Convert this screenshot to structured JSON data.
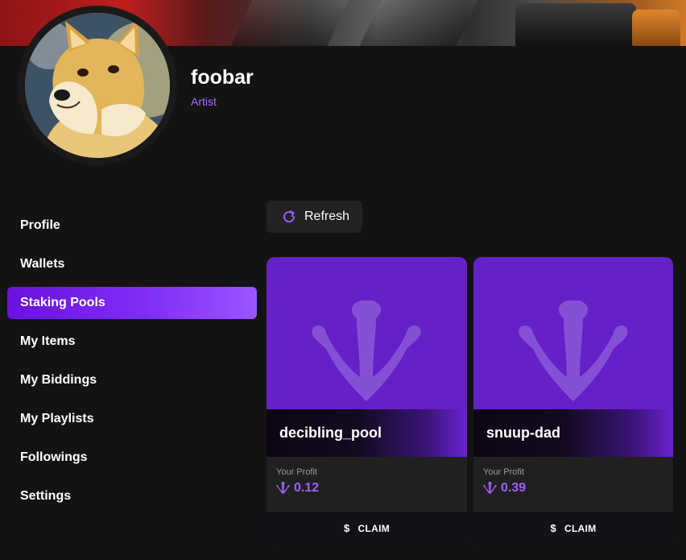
{
  "profile": {
    "username": "foobar",
    "role": "Artist"
  },
  "sidebar": {
    "items": [
      {
        "label": "Profile",
        "active": false
      },
      {
        "label": "Wallets",
        "active": false
      },
      {
        "label": "Staking Pools",
        "active": true
      },
      {
        "label": "My Items",
        "active": false
      },
      {
        "label": "My Biddings",
        "active": false
      },
      {
        "label": "My Playlists",
        "active": false
      },
      {
        "label": "Followings",
        "active": false
      },
      {
        "label": "Settings",
        "active": false
      }
    ]
  },
  "toolbar": {
    "refresh_label": "Refresh",
    "refresh_icon": "refresh-icon"
  },
  "pools": [
    {
      "name": "decibling_pool",
      "profit_label": "Your Profit",
      "profit_value": "0.12",
      "claim_label": "CLAIM",
      "claim_icon": "$"
    },
    {
      "name": "snuup-dad",
      "profit_label": "Your Profit",
      "profit_value": "0.39",
      "claim_label": "CLAIM",
      "claim_icon": "$"
    }
  ],
  "colors": {
    "accent": "#7f2df5",
    "card_image": "#6620c8",
    "role": "#a66cff",
    "background": "#131313"
  }
}
